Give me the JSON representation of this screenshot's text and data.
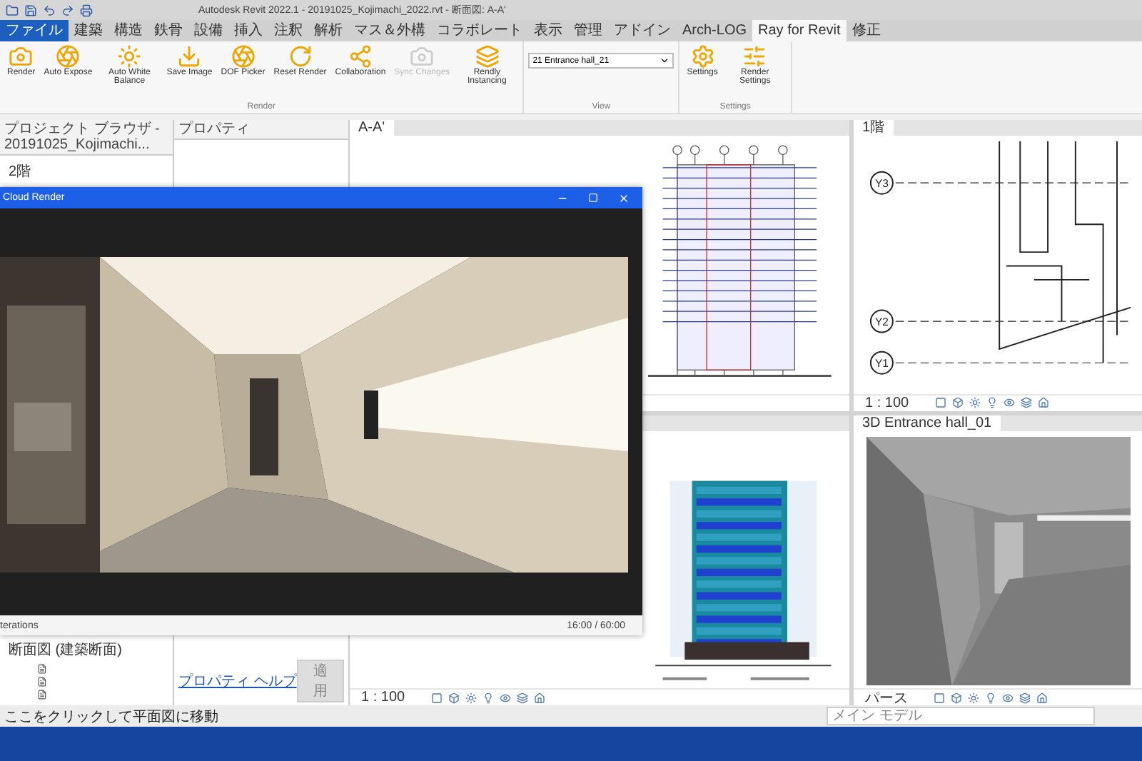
{
  "title_bar": {
    "title": "Autodesk Revit 2022.1 - 20191025_Kojimachi_2022.rvt - 断面図: A-A'"
  },
  "ribbon_tabs": [
    {
      "label": "ファイル",
      "kind": "file",
      "selected": false
    },
    {
      "label": "建築",
      "kind": "tab",
      "selected": false
    },
    {
      "label": "構造",
      "kind": "tab",
      "selected": false
    },
    {
      "label": "鉄骨",
      "kind": "tab",
      "selected": false
    },
    {
      "label": "設備",
      "kind": "tab",
      "selected": false
    },
    {
      "label": "挿入",
      "kind": "tab",
      "selected": false
    },
    {
      "label": "注釈",
      "kind": "tab",
      "selected": false
    },
    {
      "label": "解析",
      "kind": "tab",
      "selected": false
    },
    {
      "label": "マス＆外構",
      "kind": "tab",
      "selected": false
    },
    {
      "label": "コラボレート",
      "kind": "tab",
      "selected": false
    },
    {
      "label": "表示",
      "kind": "tab",
      "selected": false
    },
    {
      "label": "管理",
      "kind": "tab",
      "selected": false
    },
    {
      "label": "アドイン",
      "kind": "tab",
      "selected": false
    },
    {
      "label": "Arch-LOG",
      "kind": "tab",
      "selected": false
    },
    {
      "label": "Ray for Revit",
      "kind": "tab",
      "selected": true
    },
    {
      "label": "修正",
      "kind": "tab",
      "selected": false
    }
  ],
  "ribbon_panels": [
    {
      "label": "Render",
      "kind": "buttons",
      "buttons": [
        {
          "label": "Render",
          "disabled": false
        },
        {
          "label": "Auto Expose",
          "disabled": false
        },
        {
          "label": "Auto White Balance",
          "disabled": false
        },
        {
          "label": "Save Image",
          "disabled": false
        },
        {
          "label": "DOF Picker",
          "disabled": false
        },
        {
          "label": "Reset Render",
          "disabled": false
        },
        {
          "label": "Collaboration",
          "disabled": false
        },
        {
          "label": "Sync Changes",
          "disabled": true
        },
        {
          "label": "Rendly Instancing",
          "disabled": false
        }
      ]
    },
    {
      "label": "View",
      "kind": "dropdown",
      "value": "21 Entrance hall_21"
    },
    {
      "label": "Settings",
      "kind": "buttons",
      "buttons": [
        {
          "label": "Settings",
          "disabled": false
        },
        {
          "label": "Render Settings",
          "disabled": false
        }
      ]
    }
  ],
  "project_browser": {
    "title": "プロジェクト ブラウザ - 20191025_Kojimachi...",
    "items": [
      {
        "label": "2階"
      },
      {
        "label": "断面図 (建築断面)"
      }
    ]
  },
  "properties": {
    "title": "プロパティ",
    "help_link": "プロパティ ヘルプ",
    "apply_button": "適用"
  },
  "views": [
    {
      "title": "A-A'",
      "kind": "section"
    },
    {
      "kind": "elevation",
      "scale": "1 : 100"
    },
    {
      "title": "1階",
      "kind": "plan",
      "scale": "1 : 100",
      "grid_labels": [
        "Y3",
        "Y2",
        "Y1"
      ]
    },
    {
      "title": "3D Entrance hall_01",
      "kind": "perspective",
      "scale": "パース"
    }
  ],
  "render_window": {
    "title": "Cloud Render",
    "status_left": "terations",
    "status_right": "16:00 / 60:00"
  },
  "status_bar": {
    "message": "ここをクリックして平面図に移動",
    "model": "メイン モデル"
  }
}
